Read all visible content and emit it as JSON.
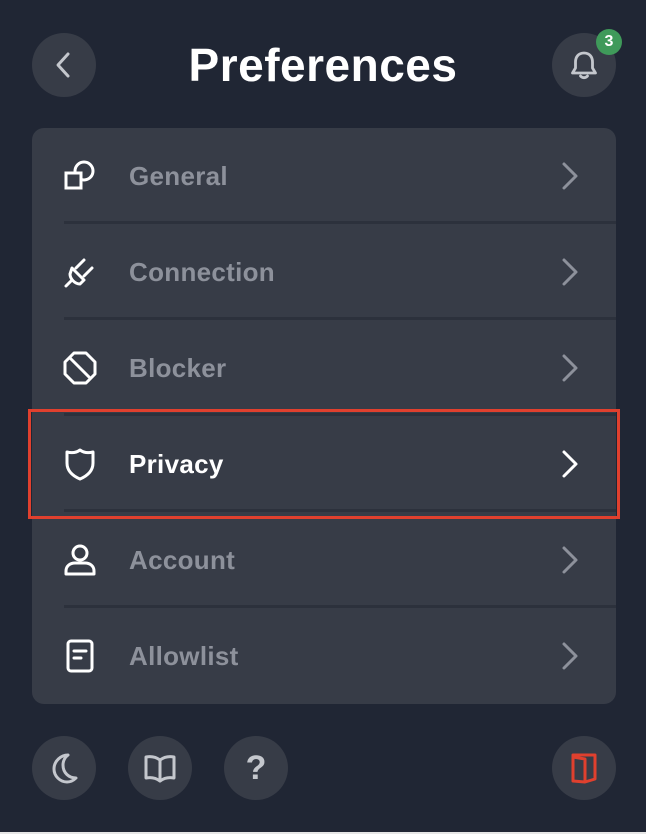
{
  "header": {
    "title": "Preferences",
    "notification_count": "3"
  },
  "menu": {
    "items": [
      {
        "label": "General",
        "icon": "general-shapes-icon"
      },
      {
        "label": "Connection",
        "icon": "plug-icon"
      },
      {
        "label": "Blocker",
        "icon": "block-icon"
      },
      {
        "label": "Privacy",
        "icon": "shield-icon",
        "active": true
      },
      {
        "label": "Account",
        "icon": "user-icon"
      },
      {
        "label": "Allowlist",
        "icon": "document-list-icon"
      }
    ]
  },
  "footer": {
    "help_glyph": "?"
  },
  "colors": {
    "background": "#202634",
    "card": "#373c47",
    "active_text": "#ffffff",
    "inactive_text": "#8d919b",
    "highlight": "#e0402e",
    "badge": "#3f9a5a",
    "brand_logo": "#e0402e"
  }
}
